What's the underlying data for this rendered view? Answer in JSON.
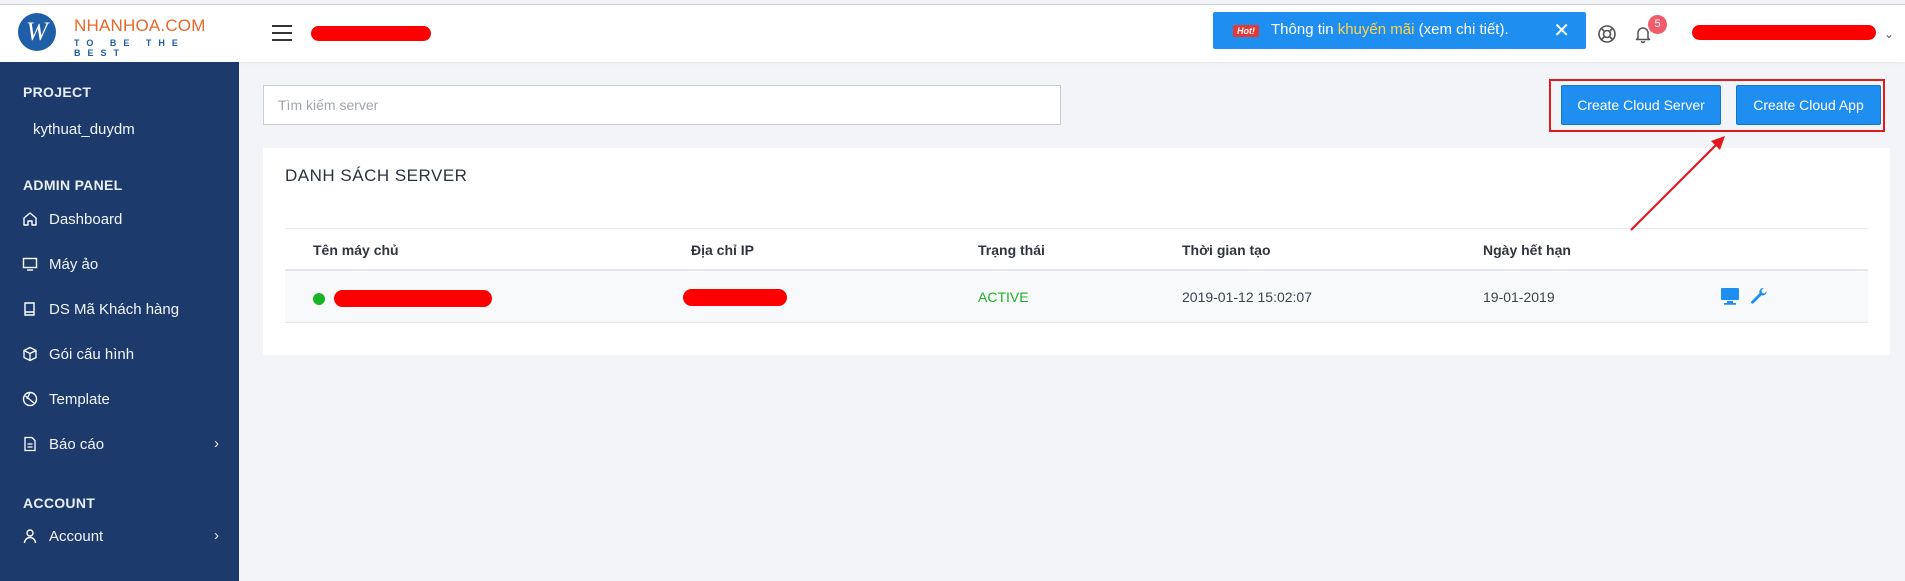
{
  "header": {
    "logo_letter": "W",
    "logo_name": "NHANHOA.COM",
    "logo_tagline": "TO BE THE BEST",
    "promo": {
      "hot_label": "Hot!",
      "text_before": "Thông tin ",
      "text_highlight": "khuyến mãi",
      "text_after": " (xem chi tiết).",
      "close_glyph": "✕"
    },
    "notification_count": "5",
    "user_caret": "⌄"
  },
  "sidebar": {
    "project_heading": "PROJECT",
    "project_name": "kythuat_duydm",
    "admin_heading": "ADMIN PANEL",
    "admin_items": [
      {
        "label": "Dashboard",
        "icon": "home-icon"
      },
      {
        "label": "Máy ảo",
        "icon": "monitor-icon"
      },
      {
        "label": "DS Mã Khách hàng",
        "icon": "book-icon"
      },
      {
        "label": "Gói cấu hình",
        "icon": "box-icon"
      },
      {
        "label": "Template",
        "icon": "template-icon"
      },
      {
        "label": "Báo cáo",
        "icon": "report-icon",
        "chevron": "›"
      }
    ],
    "account_heading": "ACCOUNT",
    "account_items": [
      {
        "label": "Account",
        "icon": "user-icon",
        "chevron": "›"
      }
    ]
  },
  "main": {
    "search_placeholder": "Tìm kiếm server",
    "create_server_label": "Create Cloud Server",
    "create_app_label": "Create Cloud App",
    "list_title": "DANH SÁCH SERVER",
    "columns": [
      "Tên máy chủ",
      "Địa chỉ IP",
      "Trạng thái",
      "Thời gian tạo",
      "Ngày hết hạn"
    ],
    "rows": [
      {
        "status": "ACTIVE",
        "created": "2019-01-12 15:02:07",
        "expires": "19-01-2019"
      }
    ]
  },
  "colors": {
    "sidebar_bg": "#1d3a6c",
    "accent": "#1e8ff0",
    "status_active": "#1bb328",
    "highlight_border": "#e01b1b"
  }
}
